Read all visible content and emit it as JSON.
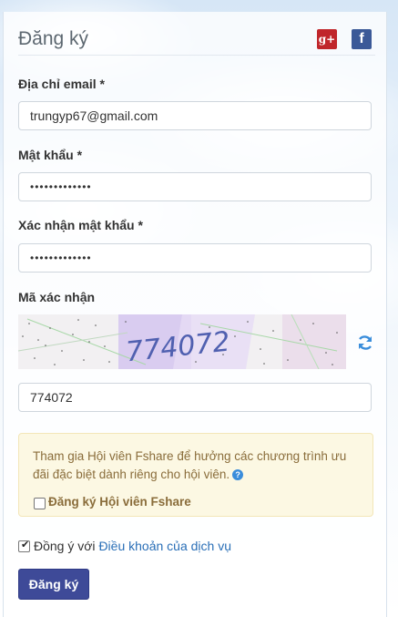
{
  "form": {
    "title": "Đăng ký",
    "email_label": "Địa chỉ email *",
    "email_value": "trungyp67@gmail.com",
    "password_label": "Mật khẩu *",
    "password_value": "•••••••••••••",
    "confirm_label": "Xác nhận mật khẩu *",
    "confirm_value": "•••••••••••••",
    "captcha_label": "Mã xác nhận",
    "captcha_image_text": "774072",
    "captcha_value": "774072",
    "vip_notice": "Tham gia Hội viên Fshare để hưởng các chương trình ưu đãi đặc biệt dành riêng cho hội viên.",
    "vip_checkbox_label": "Đăng ký Hội viên Fshare",
    "agree_text": "Đồng ý với ",
    "terms_link": "Điều khoản của dịch vụ",
    "submit_label": "Đăng ký"
  },
  "social": {
    "gplus_label": "g+",
    "facebook_label": "f"
  },
  "icons": {
    "gplus": "google-plus-icon",
    "facebook": "facebook-icon",
    "refresh": "refresh-icon",
    "help": "question-circle-icon"
  },
  "colors": {
    "submit": "#3e4a98",
    "link": "#2a6fb7",
    "notice_bg": "#fcf8e3",
    "notice_text": "#8a6d3b"
  },
  "checkboxes": {
    "vip_checked": false,
    "agree_checked": true
  }
}
